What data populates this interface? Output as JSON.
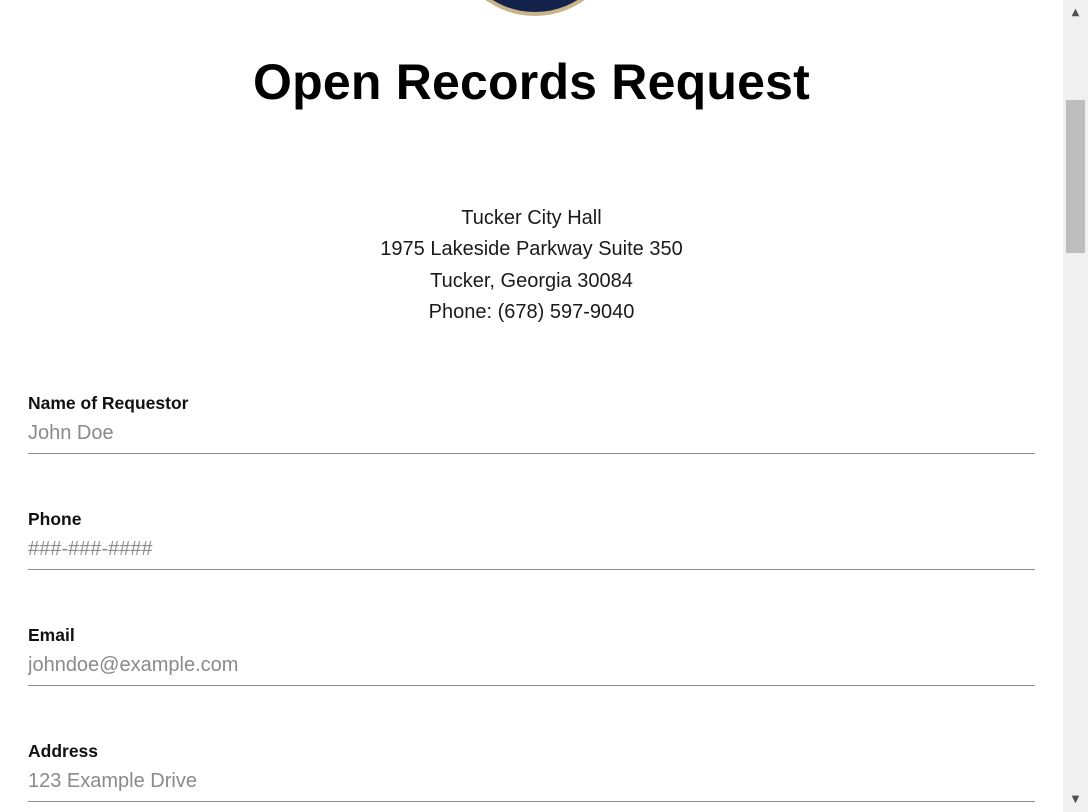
{
  "page": {
    "title": "Open Records Request",
    "seal_icon": "city-seal-icon"
  },
  "address": {
    "line1": "Tucker City Hall",
    "line2": "1975 Lakeside Parkway Suite 350",
    "line3": "Tucker, Georgia 30084",
    "line4": "Phone: (678) 597-9040"
  },
  "form": {
    "name": {
      "label": "Name of Requestor",
      "placeholder": "John Doe",
      "value": ""
    },
    "phone": {
      "label": "Phone",
      "placeholder": "###-###-####",
      "value": ""
    },
    "email": {
      "label": "Email",
      "placeholder": "johndoe@example.com",
      "value": ""
    },
    "address": {
      "label": "Address",
      "placeholder": "123 Example Drive",
      "value": ""
    }
  },
  "scrollbar": {
    "up_icon": "▲",
    "down_icon": "▼"
  },
  "colors": {
    "seal_navy": "#12224a",
    "seal_gold": "#c9b48a",
    "field_underline": "#8c8c8c",
    "placeholder_gray": "#8a8a8a"
  }
}
